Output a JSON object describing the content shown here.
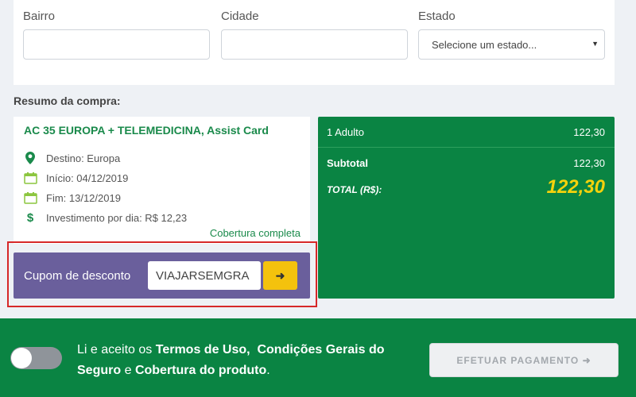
{
  "address": {
    "neighborhood_label": "Bairro",
    "neighborhood_value": "",
    "city_label": "Cidade",
    "city_value": "",
    "state_label": "Estado",
    "state_selected": "Selecione um estado..."
  },
  "summary": {
    "title": "Resumo da compra:",
    "product_name": "AC 35 EUROPA + TELEMEDICINA, Assist Card",
    "details": [
      {
        "icon": "map-pin-icon",
        "text": "Destino: Europa"
      },
      {
        "icon": "calendar-icon",
        "text": "Início: 04/12/2019"
      },
      {
        "icon": "calendar-icon",
        "text": "Fim: 13/12/2019"
      },
      {
        "icon": "dollar-icon",
        "text": "Investimento por dia: R$ 12,23"
      }
    ],
    "coverage_link": "Cobertura completa"
  },
  "coupon": {
    "label": "Cupom de desconto",
    "value": "VIAJARSEMGRA",
    "button_symbol": "➜"
  },
  "totals": {
    "adult_label": "1 Adulto",
    "adult_value": "122,30",
    "subtotal_label": "Subtotal",
    "subtotal_value": "122,30",
    "total_label": "TOTAL (R$):",
    "total_value": "122,30"
  },
  "footer": {
    "terms_prefix": "Li e aceito os",
    "terms_of_use": "Termos de Uso,",
    "general_conditions": "Condições Gerais do Seguro",
    "conjunction": "e",
    "product_coverage": "Cobertura do produto",
    "terms_suffix": ".",
    "pay_button": "EFETUAR PAGAMENTO ➜"
  },
  "colors": {
    "brand_green": "#0a8443",
    "coupon_purple": "#6a5f9c",
    "accent_yellow": "#f4c20d",
    "highlight_red": "#d62828"
  }
}
